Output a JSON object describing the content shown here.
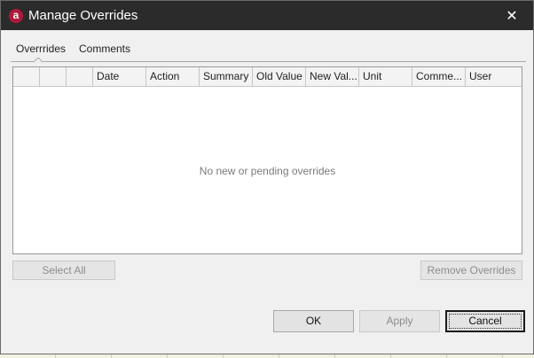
{
  "window": {
    "title": "Manage Overrides",
    "app_icon_glyph": "a",
    "close_glyph": "✕"
  },
  "tabs": [
    {
      "label": "Overrrides",
      "active": true
    },
    {
      "label": "Comments",
      "active": false
    }
  ],
  "grid": {
    "columns": [
      "",
      "",
      "",
      "Date",
      "Action",
      "Summary",
      "Old Value",
      "New Val...",
      "Unit",
      "Comme...",
      "User"
    ],
    "empty_message": "No new or pending overrides"
  },
  "buttons": {
    "select_all": "Select All",
    "remove_overrides": "Remove Overrides",
    "ok": "OK",
    "apply": "Apply",
    "cancel": "Cancel"
  },
  "colors": {
    "titlebar": "#2b2b2b",
    "app_icon": "#b0193a",
    "dialog_bg": "#f0f0f0"
  }
}
